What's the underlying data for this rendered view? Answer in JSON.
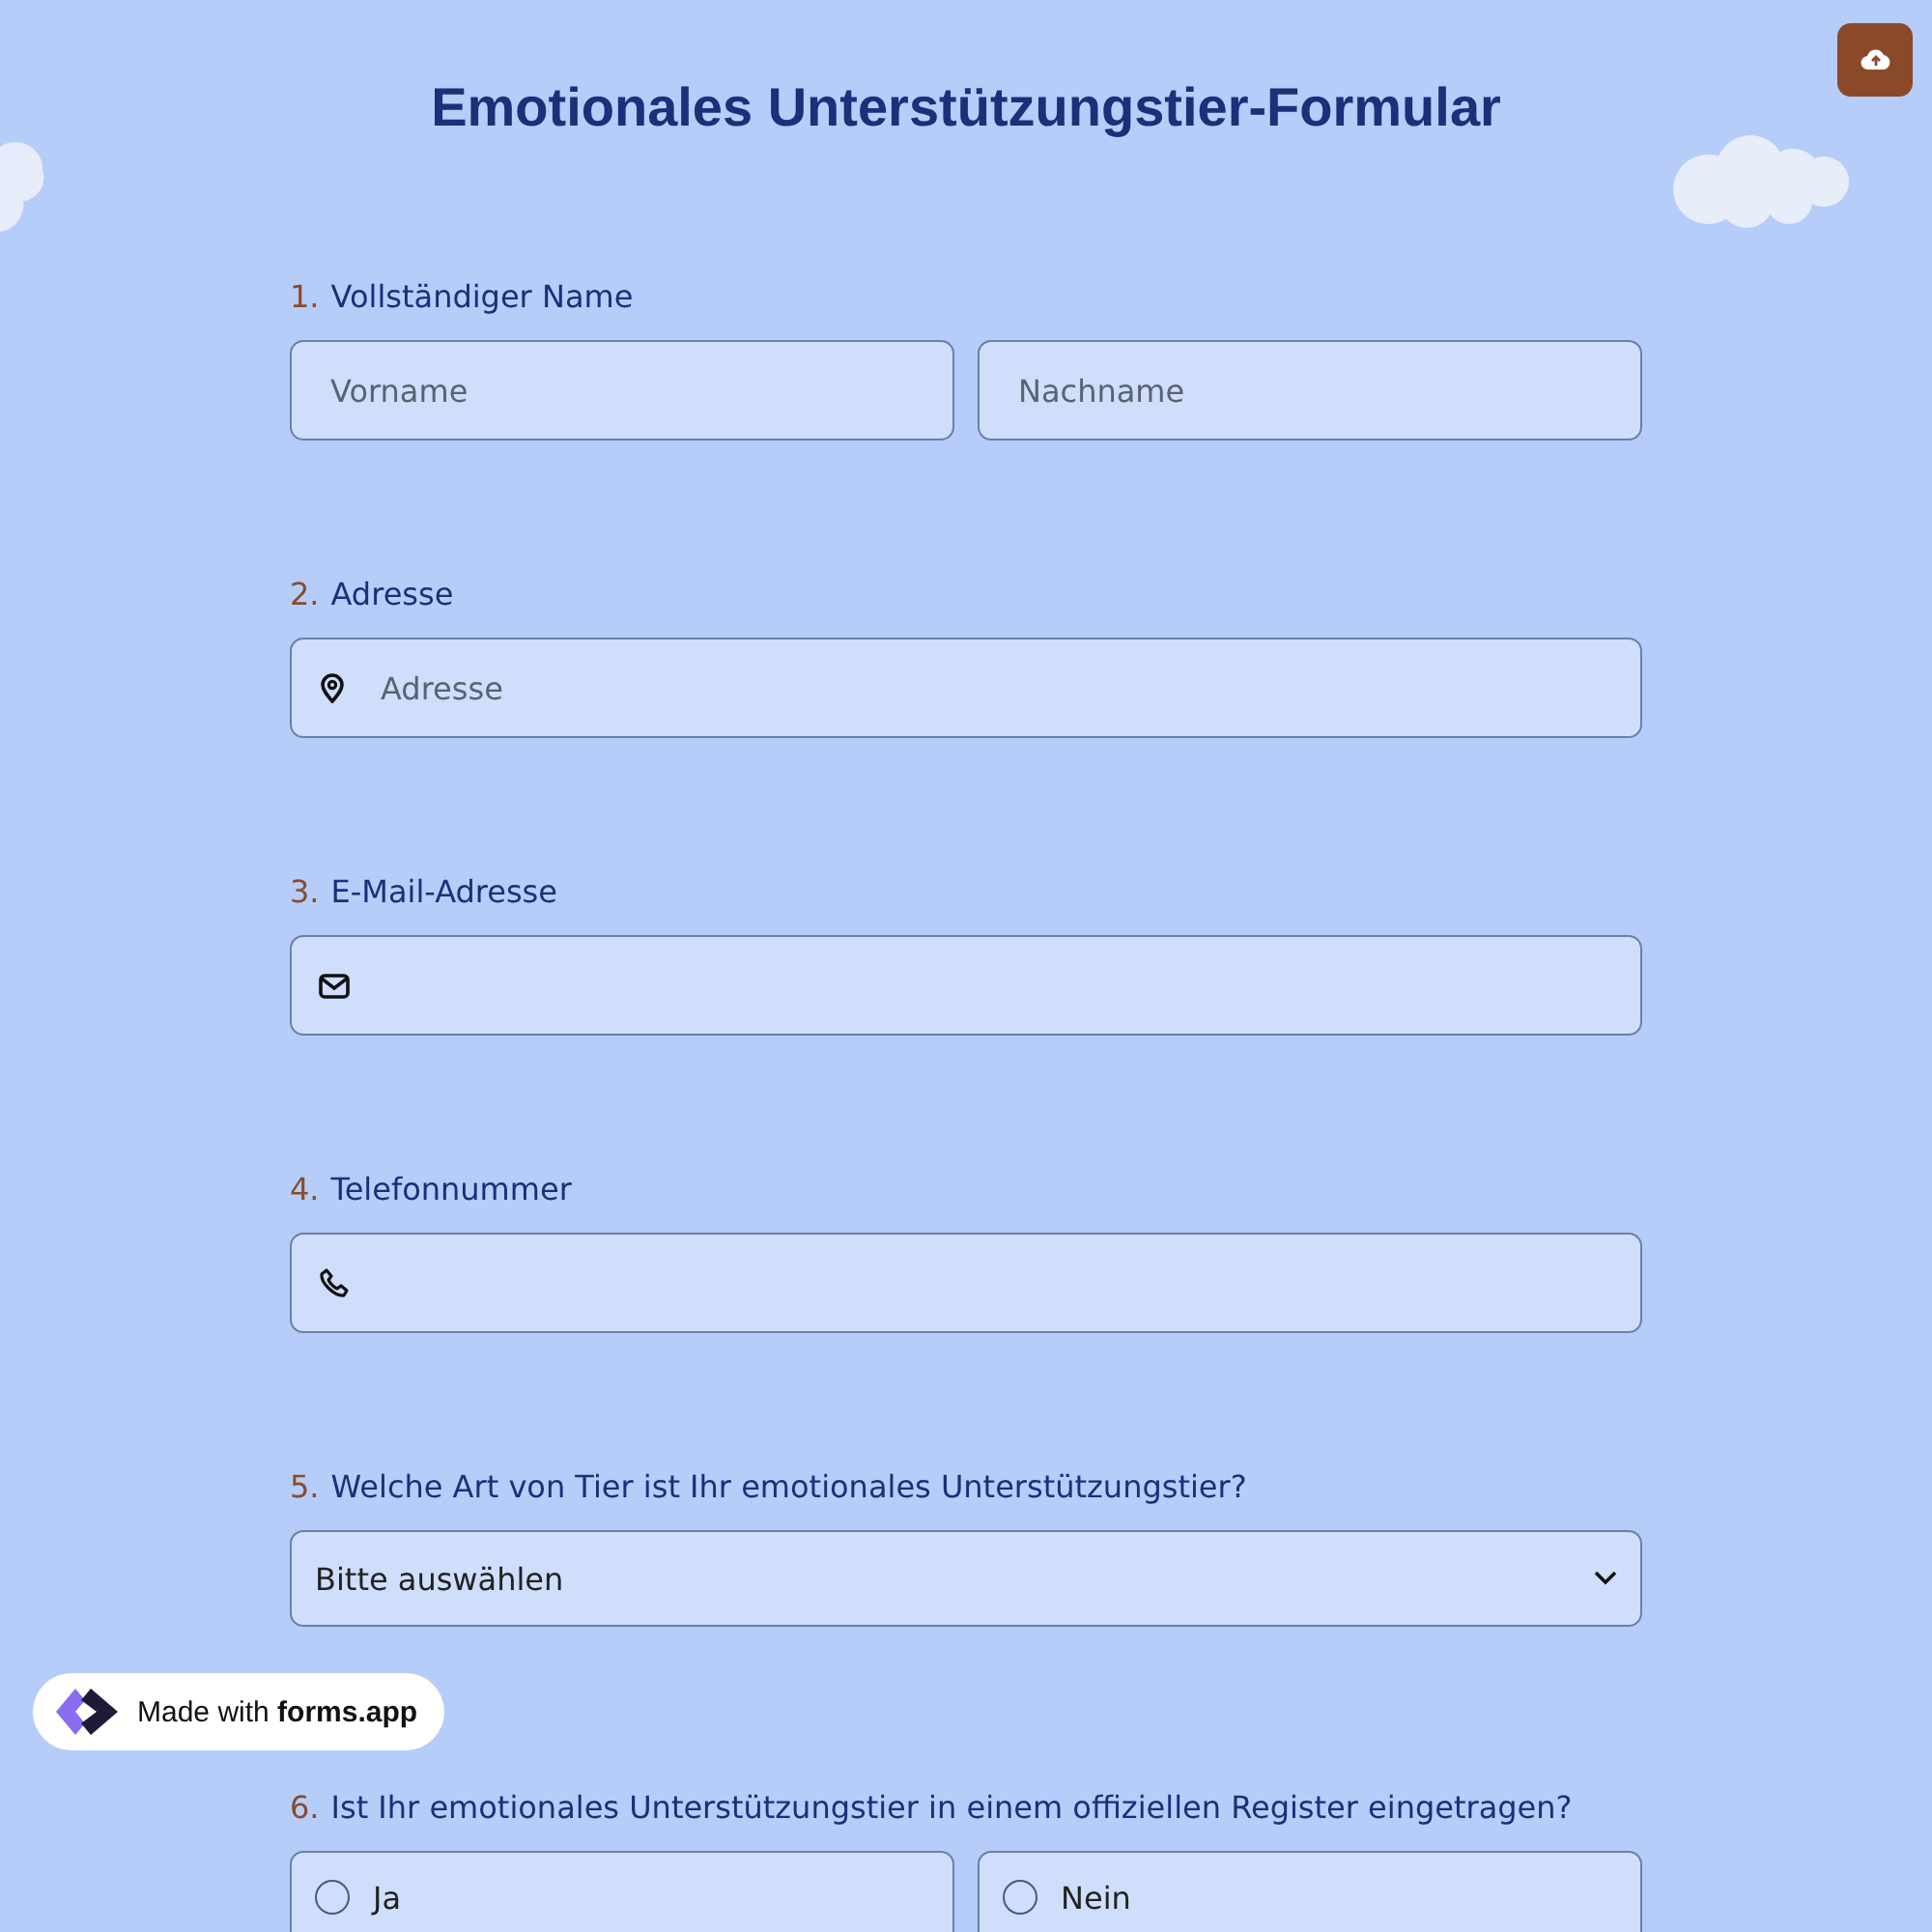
{
  "title": "Emotionales Unterstützungstier-Formular",
  "questions": [
    {
      "number": "1.",
      "label": "Vollständiger Name",
      "kind": "name",
      "fields": [
        {
          "placeholder": "Vorname"
        },
        {
          "placeholder": "Nachname"
        }
      ]
    },
    {
      "number": "2.",
      "label": "Adresse",
      "kind": "address",
      "fields": [
        {
          "placeholder": "Adresse"
        }
      ]
    },
    {
      "number": "3.",
      "label": "E-Mail-Adresse",
      "kind": "email"
    },
    {
      "number": "4.",
      "label": "Telefonnummer",
      "kind": "phone"
    },
    {
      "number": "5.",
      "label": "Welche Art von Tier ist Ihr emotionales Unterstützungstier?",
      "kind": "select",
      "value": "Bitte auswählen"
    },
    {
      "number": "6.",
      "label": "Ist Ihr emotionales Unterstützungstier in einem offiziellen Register eingetragen?",
      "kind": "radio",
      "options": [
        {
          "label": "Ja",
          "selected": false
        },
        {
          "label": "Nein",
          "selected": false
        }
      ]
    }
  ],
  "badge": "Made with **forms.app**"
}
